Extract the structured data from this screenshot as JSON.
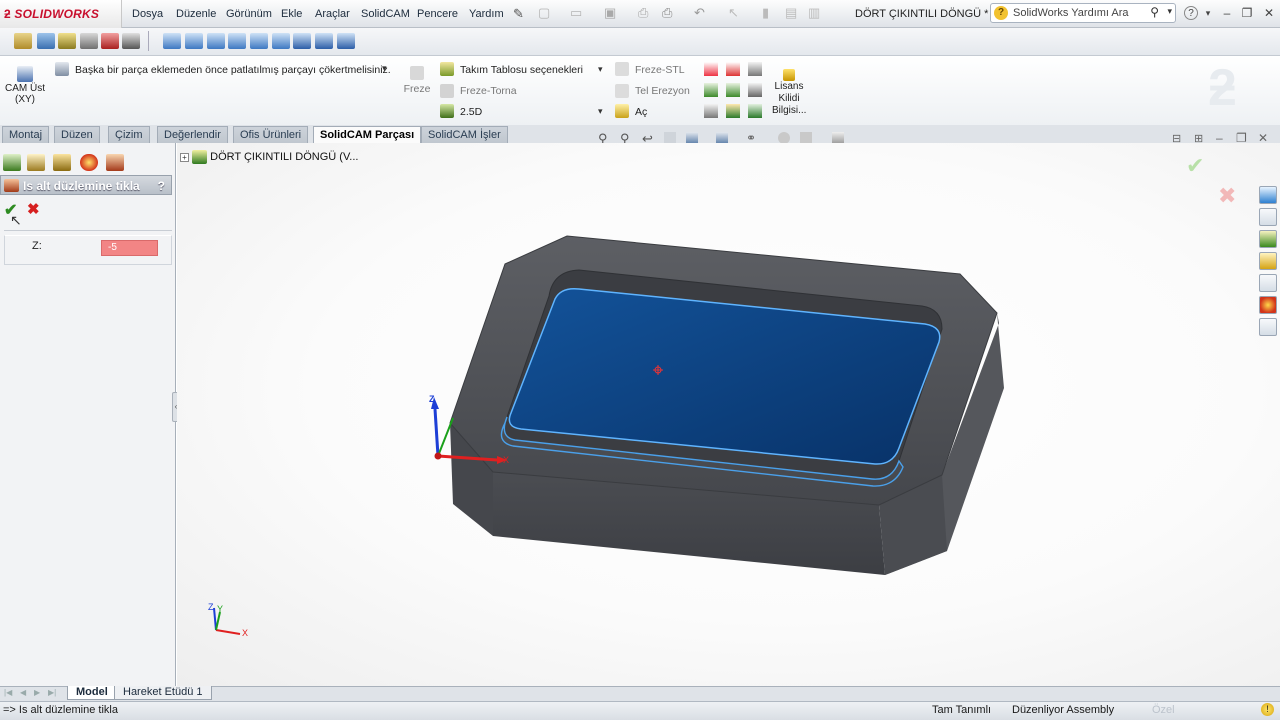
{
  "app": {
    "logo": "SOLIDWORKS",
    "document_title": "DÖRT ÇIKINTILI DÖNGÜ *"
  },
  "menu": [
    "Dosya",
    "Düzenle",
    "Görünüm",
    "Ekle",
    "Araçlar",
    "SolidCAM",
    "Pencere",
    "Yardım"
  ],
  "help_search": {
    "placeholder": "SolidWorks Yardımı Ara"
  },
  "ribbon": {
    "cam_ust": "CAM Üst",
    "cam_ust_sub": "(XY)",
    "warning": "Başka bir parça eklemeden önce patlatılmış parçayı çökertmelisiniz.",
    "freze": "Freze",
    "takim_tablosu": "Takım Tablosu seçenekleri",
    "freze_torna": "Freze-Torna",
    "mode_2_5d": "2.5D",
    "freze_stl": "Freze-STL",
    "tel_erezyon": "Tel Erezyon",
    "ac": "Aç",
    "lisans": [
      "Lisans",
      "Kilidi",
      "Bilgisi..."
    ]
  },
  "tabs": [
    {
      "label": "Montaj",
      "active": false
    },
    {
      "label": "Düzen",
      "active": false
    },
    {
      "label": "Çizim",
      "active": false
    },
    {
      "label": "Değerlendir",
      "active": false
    },
    {
      "label": "Ofis Ürünleri",
      "active": false
    },
    {
      "label": "SolidCAM Parçası",
      "active": true
    },
    {
      "label": "SolidCAM İşler",
      "active": false
    }
  ],
  "property_manager": {
    "title": "Is alt düzlemine tikla",
    "help_mark": "?",
    "z_label": "Z:",
    "z_value": "-5"
  },
  "tree": {
    "root_label": "DÖRT ÇIKINTILI DÖNGÜ  (V..."
  },
  "triad": {
    "x": "X",
    "y": "Y",
    "z": "Z"
  },
  "bottom_tabs": [
    {
      "label": "Model",
      "active": true
    },
    {
      "label": "Hareket Etüdü 1",
      "active": false
    }
  ],
  "status": {
    "prompt": "=> Is alt düzlemine tikla",
    "defined": "Tam Tanımlı",
    "editing": "Düzenliyor Assembly",
    "custom": "Özel"
  },
  "colors": {
    "accent": "#c8102e",
    "selected_face": "#0c3f78",
    "error_field": "#f28585"
  }
}
